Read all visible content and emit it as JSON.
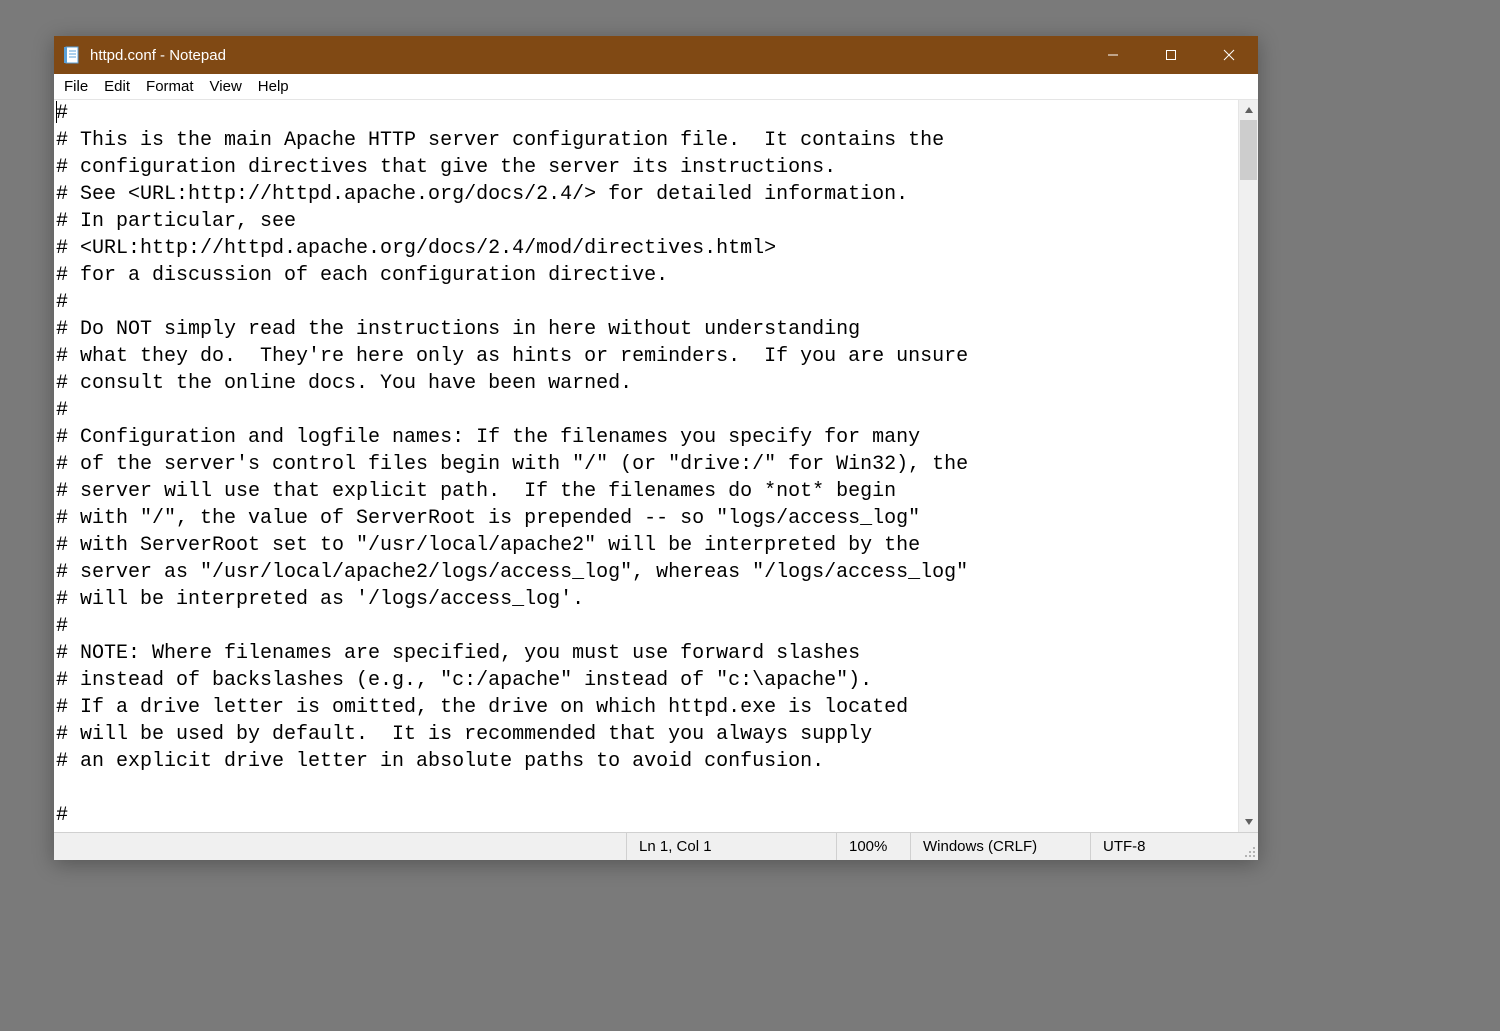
{
  "window": {
    "title": "httpd.conf - Notepad"
  },
  "menu": {
    "file": "File",
    "edit": "Edit",
    "format": "Format",
    "view": "View",
    "help": "Help"
  },
  "editor": {
    "content": "#\n# This is the main Apache HTTP server configuration file.  It contains the\n# configuration directives that give the server its instructions.\n# See <URL:http://httpd.apache.org/docs/2.4/> for detailed information.\n# In particular, see\n# <URL:http://httpd.apache.org/docs/2.4/mod/directives.html>\n# for a discussion of each configuration directive.\n#\n# Do NOT simply read the instructions in here without understanding\n# what they do.  They're here only as hints or reminders.  If you are unsure\n# consult the online docs. You have been warned.  \n#\n# Configuration and logfile names: If the filenames you specify for many\n# of the server's control files begin with \"/\" (or \"drive:/\" for Win32), the\n# server will use that explicit path.  If the filenames do *not* begin\n# with \"/\", the value of ServerRoot is prepended -- so \"logs/access_log\"\n# with ServerRoot set to \"/usr/local/apache2\" will be interpreted by the\n# server as \"/usr/local/apache2/logs/access_log\", whereas \"/logs/access_log\"\n# will be interpreted as '/logs/access_log'.\n#\n# NOTE: Where filenames are specified, you must use forward slashes\n# instead of backslashes (e.g., \"c:/apache\" instead of \"c:\\apache\").\n# If a drive letter is omitted, the drive on which httpd.exe is located\n# will be used by default.  It is recommended that you always supply\n# an explicit drive letter in absolute paths to avoid confusion.\n\n#"
  },
  "status": {
    "position": "Ln 1, Col 1",
    "zoom": "100%",
    "line_ending": "Windows (CRLF)",
    "encoding": "UTF-8"
  },
  "colors": {
    "titlebar_bg": "#804914",
    "titlebar_fg": "#ffffff",
    "menubar_bg": "#ffffff",
    "statusbar_bg": "#f0f0f0",
    "body_bg": "#7a7a7a"
  }
}
